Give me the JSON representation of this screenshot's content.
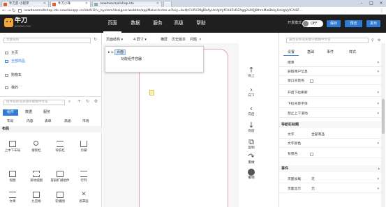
{
  "browser": {
    "tabs": [
      {
        "label": "牛刀云-小程序",
        "active": false
      },
      {
        "label": "牛刀小珠",
        "active": true
      },
      {
        "label": "newdaosmallshop-ide",
        "active": false
      }
    ],
    "url": "newdaosmallshop-ide.newdaoapp.cn/ide/UI2/v_/system/designer/webIde/appMaker/index.w?key=bxQrCUI5CMgBbAyUsUgVyfCA4ZsRZAgg2e0QJ8IhmMw8bAyUsUgVyfCA4Z..."
  },
  "header": {
    "logo_name": "牛刀",
    "logo_sub": "NEWDAO.COM",
    "nav": [
      "页面",
      "数据",
      "服务",
      "高级",
      "帮助"
    ],
    "dev_mode_label": "开发模式",
    "toggle_text": "OFF",
    "buttons": [
      "保存",
      "预览",
      "发布"
    ]
  },
  "left": {
    "search_placeholder": "页面名称",
    "pages": [
      {
        "label": "主页",
        "active": false
      },
      {
        "label": "全部商品",
        "active": true
      },
      {
        "label": "购物车",
        "active": false
      },
      {
        "label": "我的",
        "active": false
      }
    ],
    "comp_search_placeholder": "组件名称或关键字模糊中文名",
    "tabs": [
      "组件",
      "数据",
      "服务"
    ],
    "categories": [
      "布局",
      "内容",
      "表单",
      "高级",
      "市场"
    ],
    "section_title": "布局",
    "tools": [
      "上中下布局",
      "搜索栏",
      "导航栏",
      "页脚",
      "视图",
      "滚动视图",
      "容器扩展组件",
      "行列",
      "文章",
      "九宫格",
      "轮播图",
      "遮罩层"
    ]
  },
  "center": {
    "toolbar": [
      "页面结构",
      "4 屏寸",
      "横屏",
      "历史版本",
      "问题"
    ],
    "tree": {
      "root": "页面",
      "child": "功能组件容器"
    }
  },
  "actions": [
    "向上",
    "向下",
    "向后",
    "向前",
    "复制",
    "重做",
    "撤销"
  ],
  "right": {
    "search_placeholder": "属性名称或关键字模糊中文名",
    "tabs": [
      "设置",
      "基础",
      "事件",
      "样式"
    ],
    "props": [
      {
        "k": "继承",
        "v": ""
      },
      {
        "k": "获取用户信息",
        "v": ""
      },
      {
        "k": "窗口背景色",
        "v": ""
      },
      {
        "k": "开启下拉刷新",
        "v": ""
      },
      {
        "k": "下拉背景字体",
        "v": ""
      },
      {
        "k": "禁止上下滚动",
        "v": ""
      }
    ],
    "group_nav": "导航栏标题",
    "nav_props": [
      {
        "k": "文字",
        "v": "全部商品"
      },
      {
        "k": "文字颜色",
        "v": ""
      },
      {
        "k": "背景色",
        "v": ""
      }
    ],
    "group_events": "事件",
    "event_props": [
      {
        "k": "页面加载",
        "v": "无"
      },
      {
        "k": "页面显示",
        "v": "无"
      }
    ]
  }
}
